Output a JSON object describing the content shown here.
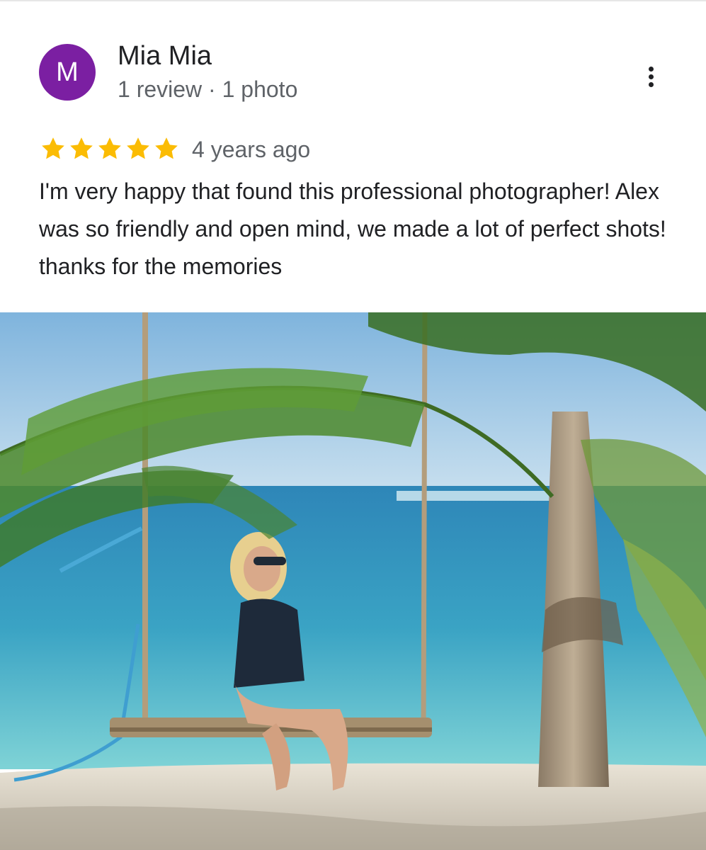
{
  "review": {
    "avatar_initial": "M",
    "avatar_color": "#7b1fa2",
    "reviewer_name": "Mia Mia",
    "reviewer_meta": "1 review · 1 photo",
    "rating": 5,
    "rating_max": 5,
    "star_color": "#fbbc04",
    "time_ago": "4 years ago",
    "text": "I'm very happy that found this professional photographer! Alex was so friendly and open mind, we made a lot of perfect shots! thanks for the memories",
    "more_icon": "more-vert-icon"
  }
}
